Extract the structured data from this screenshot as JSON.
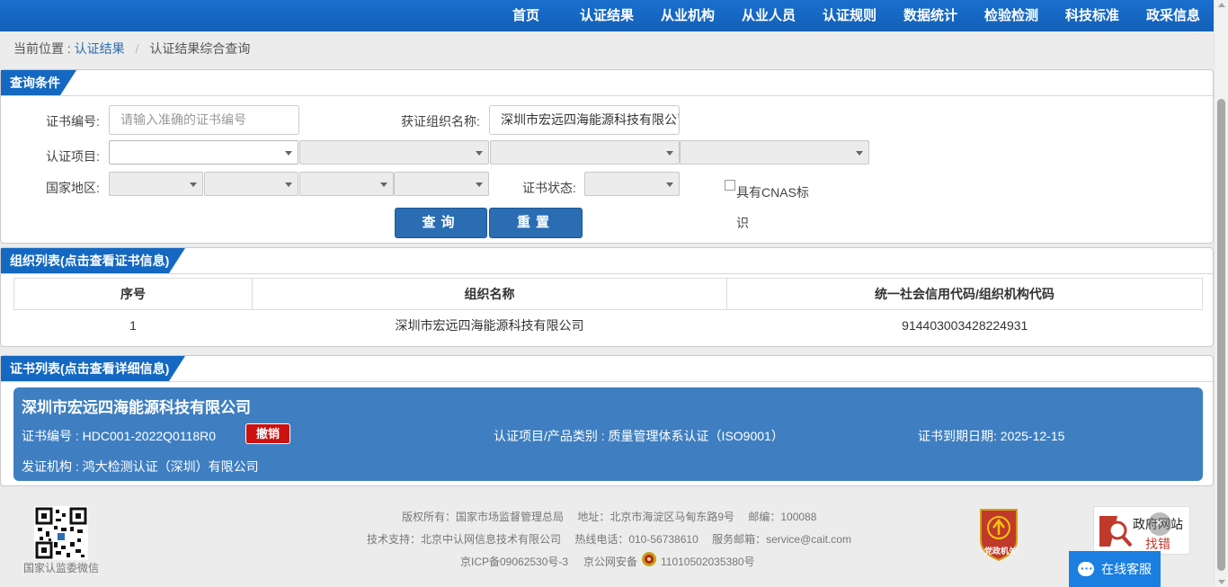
{
  "nav": {
    "items": [
      "首页",
      "认证结果",
      "从业机构",
      "从业人员",
      "认证规则",
      "数据统计",
      "检验检测",
      "科技标准",
      "政采信息"
    ]
  },
  "breadcrumb": {
    "prefix": "当前位置 :",
    "link": "认证结果",
    "separator": "/",
    "current": "认证结果综合查询"
  },
  "query": {
    "title": "查询条件",
    "cert_no_label": "证书编号:",
    "cert_no_placeholder": "请输入准确的证书编号",
    "org_name_label": "获证组织名称:",
    "org_name_value": "深圳市宏远四海能源科技有限公司",
    "project_label": "认证项目:",
    "region_label": "国家地区:",
    "status_label": "证书状态:",
    "cnas_label": "具有CNAS标识",
    "search_button": "查询",
    "reset_button": "重置"
  },
  "org_list": {
    "title": "组织列表(点击查看证书信息)",
    "columns": [
      "序号",
      "组织名称",
      "统一社会信用代码/组织机构代码"
    ],
    "rows": [
      {
        "index": "1",
        "name": "深圳市宏远四海能源科技有限公司",
        "code": "914403003428224931"
      }
    ]
  },
  "cert_list": {
    "title": "证书列表(点击查看详细信息)",
    "cards": [
      {
        "company": "深圳市宏远四海能源科技有限公司",
        "cert_no": "证书编号 : HDC001-2022Q0118R0",
        "status": "撤销",
        "project": "认证项目/产品类别 : 质量管理体系认证（ISO9001）",
        "expiry": "证书到期日期: 2025-12-15",
        "issuer": "发证机构 : 鸿大检测认证（深圳）有限公司"
      }
    ]
  },
  "footer": {
    "line1": "版权所有：国家市场监督管理总局　 地址：北京市海淀区马甸东路9号　 邮编：100088",
    "line2": "技术支持：北京中认网信息技术有限公司　 热线电话：010-56738610　 服务邮箱：service@cait.com",
    "icp": "京ICP备09062530号-3",
    "police_prefix": "京公网安备",
    "police_no": "11010502035380号",
    "qr_label": "国家认监委微信",
    "emblem_text": "党政机关",
    "gov_badge_line1": "政府网站",
    "gov_badge_line2": "找错",
    "service": "在线客服"
  },
  "colors": {
    "nav_bg": "#1565c0",
    "panel_title_bg": "#1468c2",
    "card_bg": "#3f7fc1",
    "revoke_bg": "#cc1111",
    "button_bg": "#2a6db3"
  }
}
